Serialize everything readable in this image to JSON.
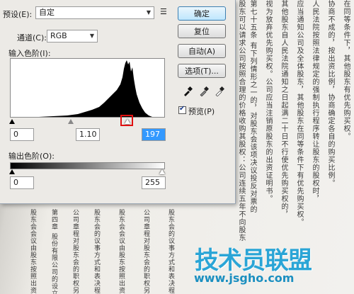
{
  "dialog": {
    "preset_label": "预设(E):",
    "preset_value": "自定",
    "channel_label": "通道(C):",
    "channel_value": "RGB",
    "input_levels_label": "输入色阶(I):",
    "input_black": "0",
    "input_gamma": "1.10",
    "input_white": "197",
    "output_levels_label": "输出色阶(O):",
    "output_black": "0",
    "output_white": "255",
    "preview_label": "预览(P)",
    "preview_checked": true,
    "buttons": {
      "ok": "确定",
      "reset": "复位",
      "auto": "自动(A)",
      "options": "选项(T)..."
    }
  },
  "background_doc": {
    "columns": [
      "在同等条件下，其他股东有优先购买权。",
      "协商不成的，按出资比例，协商确定各自的购买比例。",
      "人民法院按照法律规定的强制执行程序转让股东的股权时，",
      "应当通知公司及全体股东，其他股东在同等条件下有优先购买权。",
      "其他股东自人民法院通知之日起满二十日不行使优先购买权的，",
      "视为放弃优先购买权。公司应当注销原股东的出资证明书。",
      "第七十五条 有下列情形之一的，对股东会该项决议投反对票的",
      "股东可以请求公司按照合理的价格收购其股权：公司连续五年不向股东分配利润"
    ],
    "left_columns": [
      "股东会会议由股东按照出资比例行使表决权",
      "第四章 股份有限公司的设立和组织机构",
      "公司章程对股东会的职权另有规定的，从其规定",
      "股东会的议事方式和表决程序，除本法有规定的外"
    ]
  },
  "watermark": {
    "logo_text": "技术员联盟",
    "url_text": "www.jsgho.com"
  }
}
